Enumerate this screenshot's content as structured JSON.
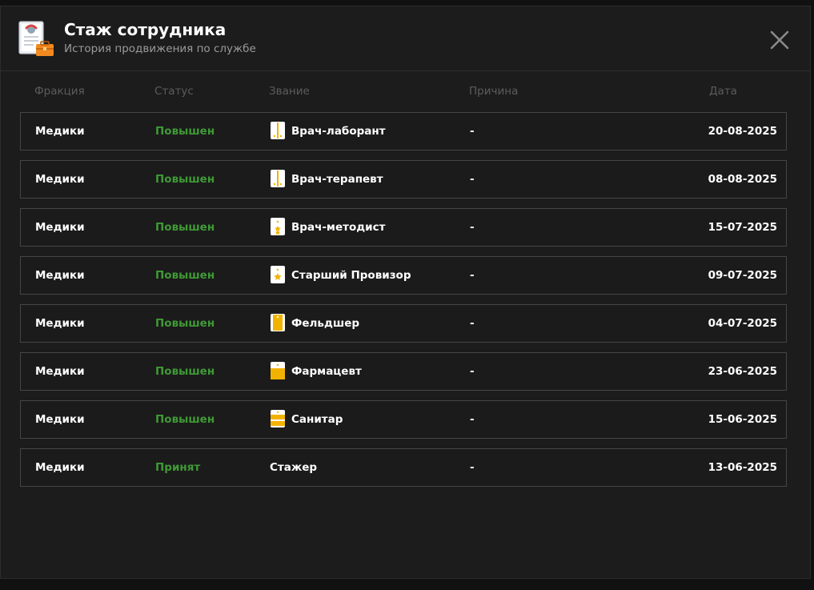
{
  "header": {
    "title": "Стаж сотрудника",
    "subtitle": "История продвижения по службе"
  },
  "columns": {
    "faction": "Фракция",
    "status": "Статус",
    "rank": "Звание",
    "reason": "Причина",
    "date": "Дата"
  },
  "colors": {
    "status_green": "#3f9a36",
    "rank_gold": "#f2b300"
  },
  "rows": [
    {
      "faction": "Медики",
      "status": "Повышен",
      "rank": "Врач-лаборант",
      "rank_icon": "epaulette-stripe-dots-icon",
      "reason": "-",
      "date": "20-08-2025"
    },
    {
      "faction": "Медики",
      "status": "Повышен",
      "rank": "Врач-терапевт",
      "rank_icon": "epaulette-stripe-dots-icon",
      "reason": "-",
      "date": "08-08-2025"
    },
    {
      "faction": "Медики",
      "status": "Повышен",
      "rank": "Врач-методист",
      "rank_icon": "epaulette-stars-icon",
      "reason": "-",
      "date": "15-07-2025"
    },
    {
      "faction": "Медики",
      "status": "Повышен",
      "rank": "Старший Провизор",
      "rank_icon": "epaulette-star-icon",
      "reason": "-",
      "date": "09-07-2025"
    },
    {
      "faction": "Медики",
      "status": "Повышен",
      "rank": "Фельдшер",
      "rank_icon": "epaulette-wide-stripe-icon",
      "reason": "-",
      "date": "04-07-2025"
    },
    {
      "faction": "Медики",
      "status": "Повышен",
      "rank": "Фармацевт",
      "rank_icon": "epaulette-bar-icon",
      "reason": "-",
      "date": "23-06-2025"
    },
    {
      "faction": "Медики",
      "status": "Повышен",
      "rank": "Санитар",
      "rank_icon": "epaulette-bars-icon",
      "reason": "-",
      "date": "15-06-2025"
    },
    {
      "faction": "Медики",
      "status": "Принят",
      "rank": "Стажер",
      "rank_icon": "",
      "reason": "-",
      "date": "13-06-2025"
    }
  ]
}
